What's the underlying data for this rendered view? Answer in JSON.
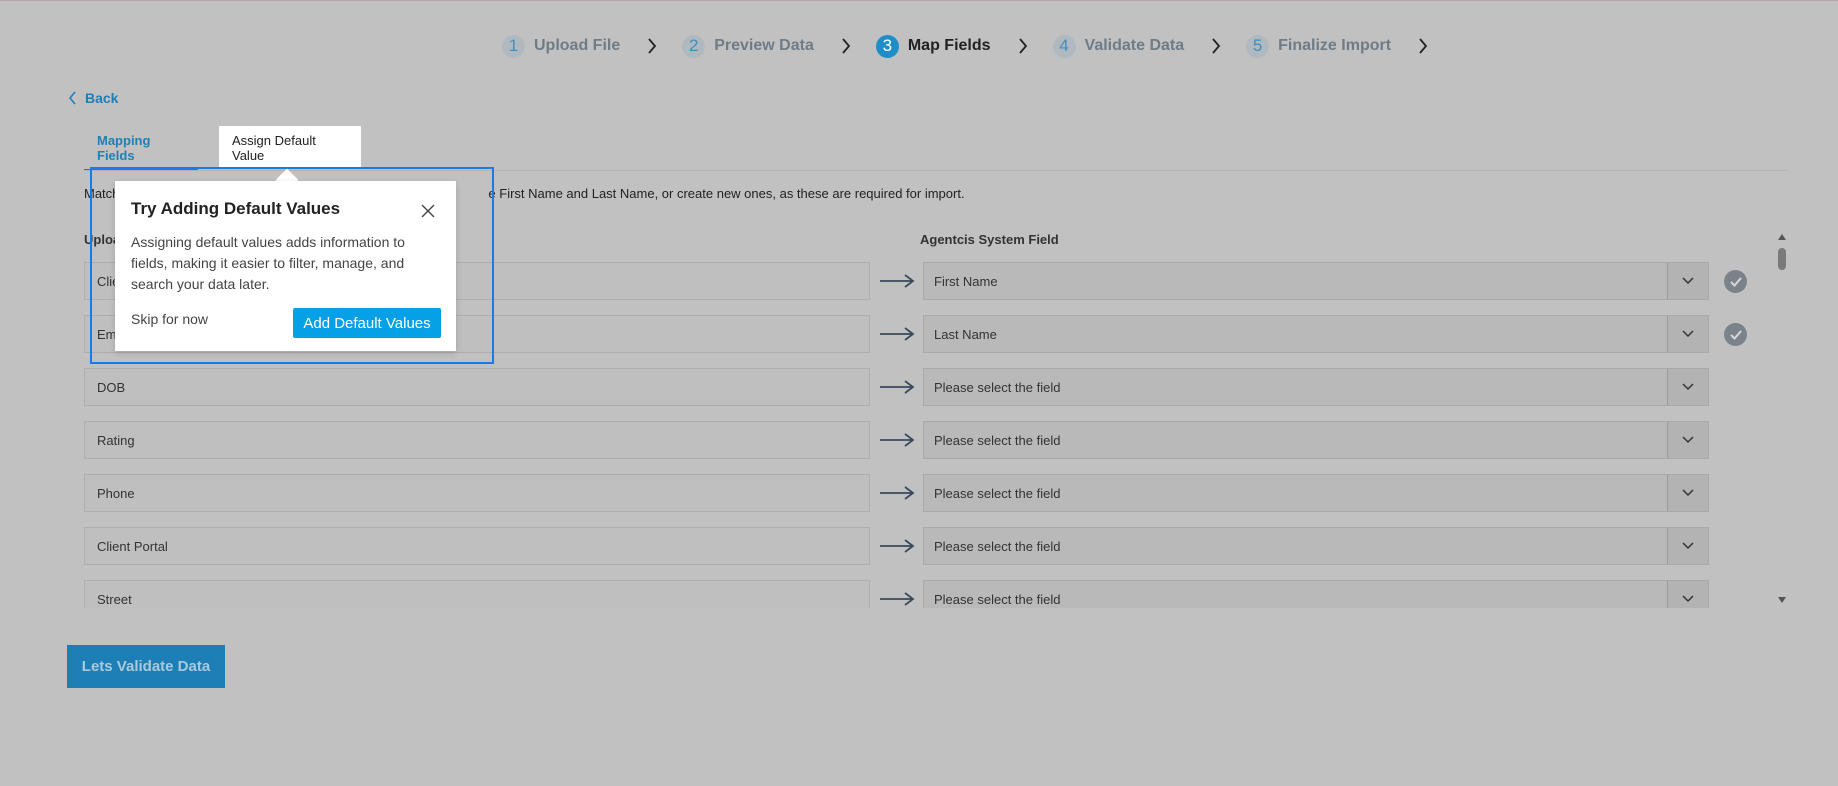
{
  "stepper": {
    "steps": [
      {
        "num": "1",
        "label": "Upload File"
      },
      {
        "num": "2",
        "label": "Preview Data"
      },
      {
        "num": "3",
        "label": "Map Fields"
      },
      {
        "num": "4",
        "label": "Validate Data"
      },
      {
        "num": "5",
        "label": "Finalize Import"
      }
    ],
    "active_step": 3
  },
  "back_label": "Back",
  "tabs": [
    "Mapping Fields",
    "Assign Default Value"
  ],
  "description": {
    "left": "Match",
    "right": "e First Name and Last Name, or create new ones, as these are required for import."
  },
  "columns": {
    "upload_partial": "Uploa",
    "system": "Agentcis System Field"
  },
  "rows": [
    {
      "upload": "Clie",
      "system": "First Name",
      "mapped": true
    },
    {
      "upload": "Em",
      "system": "Last Name",
      "mapped": true
    },
    {
      "upload": "DOB",
      "system": "Please select the field",
      "mapped": false
    },
    {
      "upload": "Rating",
      "system": "Please select the field",
      "mapped": false
    },
    {
      "upload": "Phone",
      "system": "Please select the field",
      "mapped": false
    },
    {
      "upload": "Client Portal",
      "system": "Please select the field",
      "mapped": false
    },
    {
      "upload": "Street",
      "system": "Please select the field",
      "mapped": false
    }
  ],
  "validate_button": "Lets Validate Data",
  "popup": {
    "title": "Try Adding Default Values",
    "body": "Assigning default values adds information to fields, making it easier to filter, manage, and search your data later.",
    "skip": "Skip for now",
    "add": "Add Default Values"
  },
  "colors": {
    "accent": "#1f8ec8",
    "primary_button": "#06a0e6",
    "overlay_bg": "#c1c1c1",
    "highlight_border": "#1a7ae6"
  }
}
